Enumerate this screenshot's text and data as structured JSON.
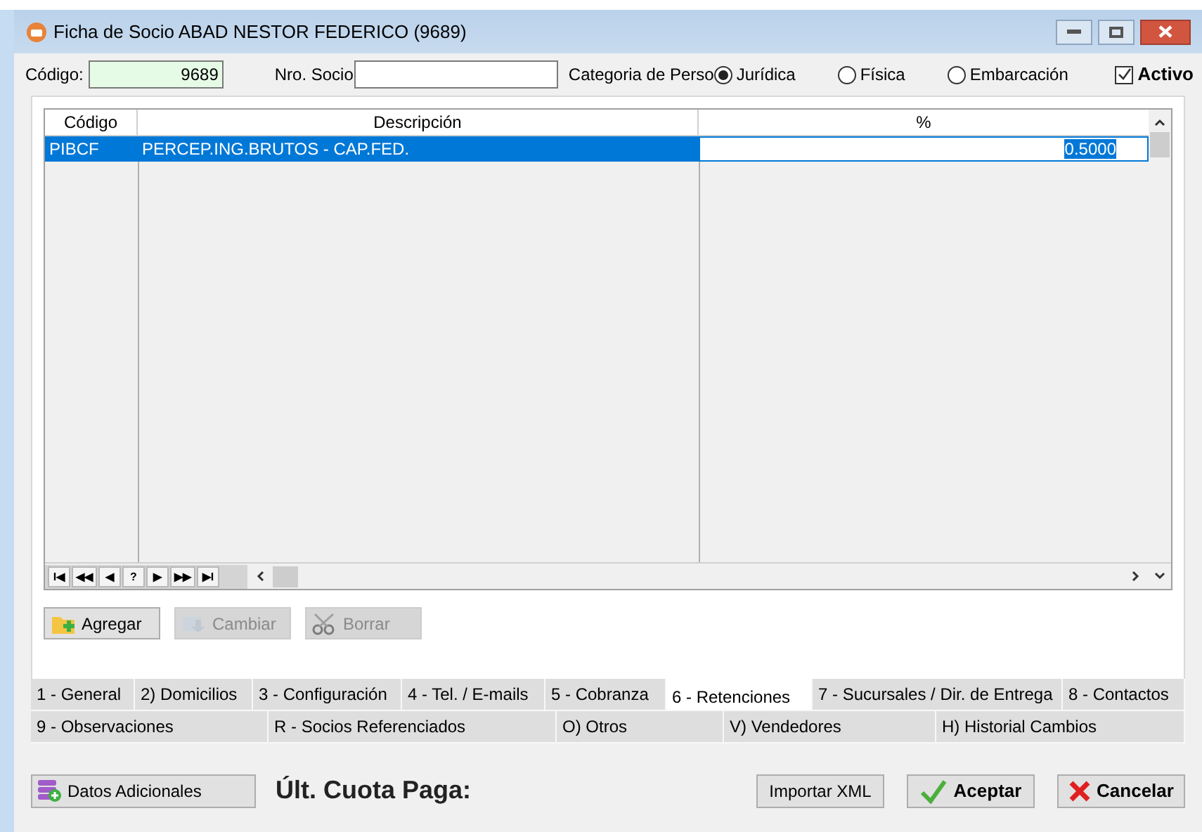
{
  "window": {
    "title": "Ficha de Socio ABAD NESTOR FEDERICO (9689)"
  },
  "form": {
    "codigo_label": "Código:",
    "codigo_value": "9689",
    "nro_socio_label": "Nro. Socio",
    "categoria_label": "Categoria de Perso",
    "categorias": [
      {
        "label": "Jurídica",
        "selected": true
      },
      {
        "label": "Física",
        "selected": false
      },
      {
        "label": "Embarcación",
        "selected": false
      }
    ],
    "activo": {
      "label": "Activo",
      "checked": true
    }
  },
  "table": {
    "columns": [
      "Código",
      "Descripción",
      "%"
    ],
    "rows": [
      {
        "cells": [
          "PIBCF",
          "PERCEP.ING.BRUTOS - CAP.FED.",
          "0.5000"
        ],
        "selected": true
      }
    ]
  },
  "navigator": [
    "I◀",
    "◀◀",
    "◀",
    "?",
    "▶",
    "▶▶",
    "▶I"
  ],
  "grid_buttons": [
    {
      "label": "Agregar",
      "kind": "add",
      "disabled": false
    },
    {
      "label": "Cambiar",
      "kind": "edit",
      "disabled": true
    },
    {
      "label": "Borrar",
      "kind": "delete",
      "disabled": true
    }
  ],
  "tabs": [
    [
      {
        "label": "1 - General",
        "selected": false
      },
      {
        "label": "2) Domicilios",
        "selected": false
      },
      {
        "label": "3 - Configuración",
        "selected": false
      },
      {
        "label": "4 - Tel. / E-mails",
        "selected": false
      },
      {
        "label": "5 - Cobranza",
        "selected": false
      },
      {
        "label": "6 - Retenciones",
        "selected": true
      },
      {
        "label": "7 - Sucursales / Dir. de Entrega",
        "selected": false
      },
      {
        "label": "8 - Contactos",
        "selected": false
      }
    ],
    [
      {
        "label": "9 - Observaciones",
        "selected": false
      },
      {
        "label": "R - Socios Referenciados",
        "selected": false
      },
      {
        "label": "O) Otros",
        "selected": false
      },
      {
        "label": "V) Vendedores",
        "selected": false
      },
      {
        "label": "H) Historial Cambios",
        "selected": false
      }
    ]
  ],
  "footer": {
    "datos_button": "Datos Adicionales",
    "ult_cuota_label": "Últ. Cuota Paga:",
    "importar_button": "Importar XML",
    "aceptar_button": "Aceptar",
    "cancelar_button": "Cancelar"
  }
}
